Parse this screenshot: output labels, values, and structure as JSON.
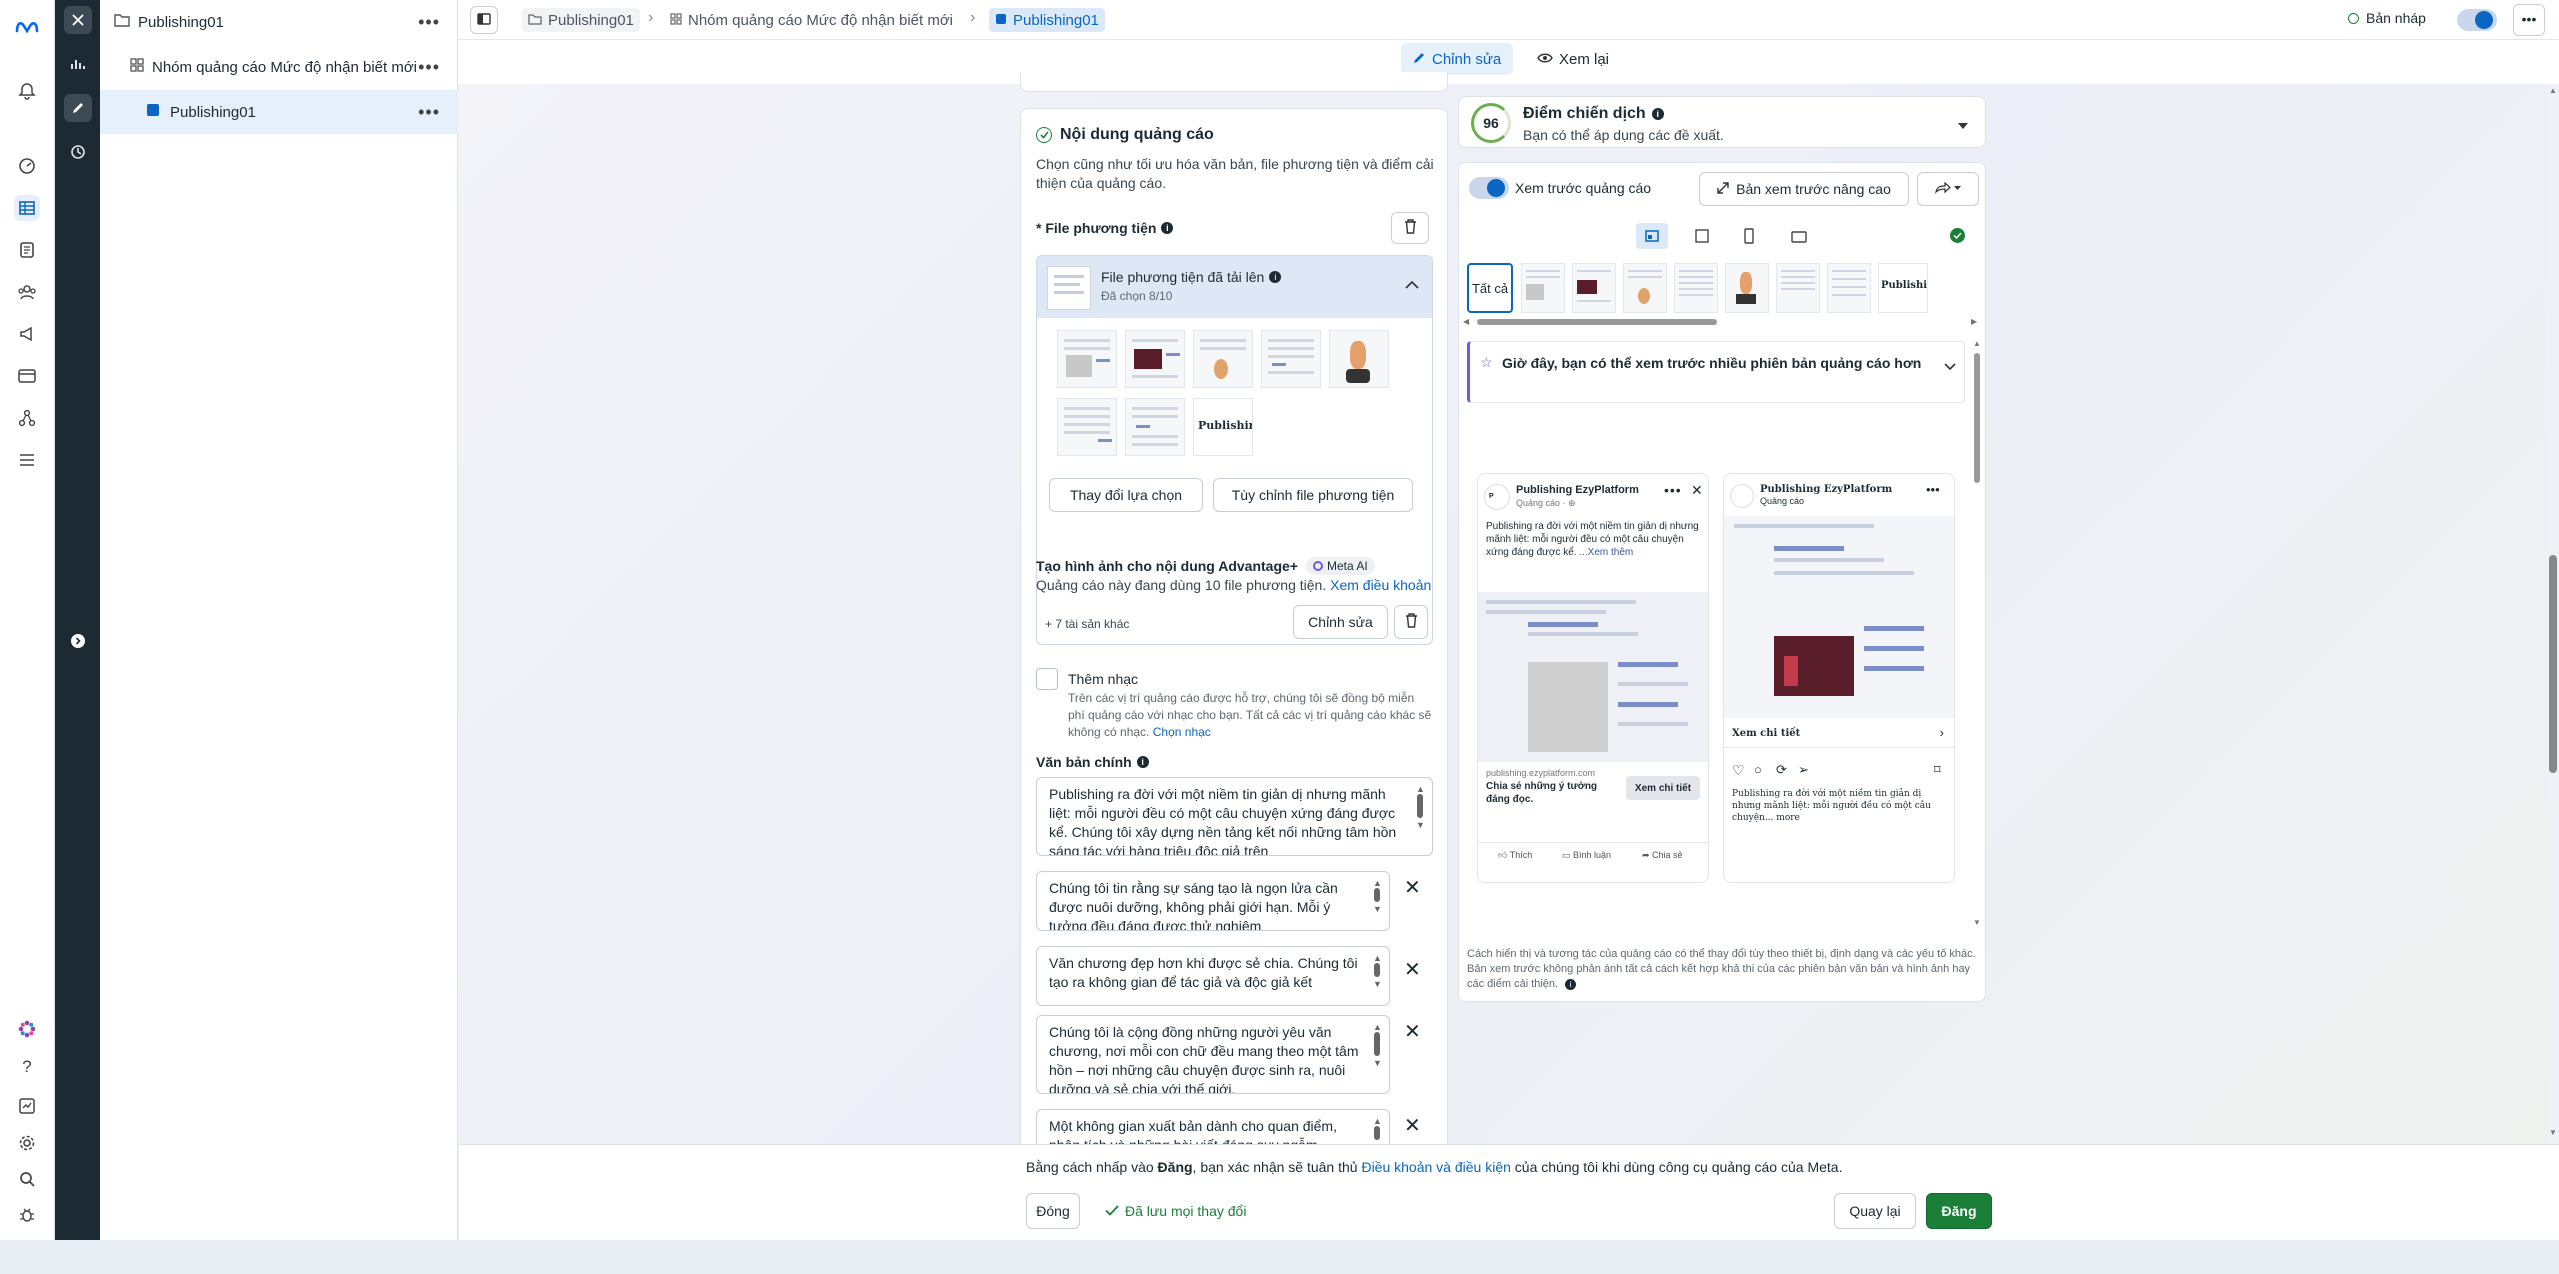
{
  "colors": {
    "accent": "#0a66c2",
    "publish": "#1a7f37",
    "rail_dark": "#1c2b33",
    "score_ring": "#6ab04c"
  },
  "icons": {
    "rail": [
      "meta-logo-icon",
      "bell-icon",
      "dashboard-icon",
      "table-icon",
      "pages-icon",
      "audience-icon",
      "megaphone-icon",
      "billing-icon",
      "network-icon",
      "menu-icon",
      "ai-flower-icon",
      "help-icon",
      "report-icon",
      "settings-icon",
      "search-icon",
      "bug-icon"
    ]
  },
  "tree": {
    "items": [
      {
        "label": "Publishing01"
      },
      {
        "label": "Nhóm quảng cáo Mức độ nhận biết mới"
      },
      {
        "label": "Publishing01"
      }
    ],
    "more": "•••"
  },
  "breadcrumb": {
    "campaign": "Publishing01",
    "adset": "Nhóm quảng cáo Mức độ nhận biết mới",
    "ad": "Publishing01",
    "sep": "›"
  },
  "topbar": {
    "draft": "Bản nháp",
    "more": "•••"
  },
  "modes": {
    "edit": "Chỉnh sửa",
    "review": "Xem lại"
  },
  "content": {
    "title": "Nội dung quảng cáo",
    "desc": "Chọn cũng như tối ưu hóa văn bản, file phương tiện và điểm cải thiện của quảng cáo.",
    "media_label": "* File phương tiện",
    "uploaded_title": "File phương tiện đã tải lên",
    "uploaded_count": "Đã chọn 8/10",
    "thumb_logo": "Publishir",
    "change_btn": "Thay đổi lựa chọn",
    "customize_btn": "Tùy chỉnh file phương tiện",
    "advantage_title": "Tạo hình ảnh cho nội dung Advantage+",
    "meta_ai": "Meta AI",
    "advantage_desc": "Quảng cáo này đang dùng 10 file phương tiện.",
    "terms_link": "Xem điều khoản",
    "other_assets": "+ 7 tài sản khác",
    "edit_btn": "Chỉnh sửa",
    "music_title": "Thêm nhạc",
    "music_desc": "Trên các vị trí quảng cáo được hỗ trợ, chúng tôi sẽ đồng bộ miễn phí quảng cáo với nhạc cho bạn. Tất cả các vị trí quảng cáo khác sẽ không có nhạc.",
    "music_link": "Chọn nhạc",
    "primary_text_label": "Văn bản chính",
    "texts": [
      "Publishing ra đời với một niềm tin giản dị nhưng mãnh liệt: mỗi người đều có một câu chuyện xứng đáng được kể. Chúng tôi xây dựng nền tảng kết nối những tâm hồn sáng tác với hàng triệu độc giả trên",
      "Chúng tôi tin rằng sự sáng tạo là ngọn lửa cần được nuôi dưỡng, không phải giới hạn. Mỗi ý tưởng đều đáng được thử nghiệm",
      "Văn chương đẹp hơn khi được sẻ chia. Chúng tôi tạo ra không gian để tác giả và độc giả kết",
      "Chúng tôi là cộng đồng những người yêu văn chương, nơi mỗi con chữ đều mang theo một tâm hồn – nơi những câu chuyện được sinh ra, nuôi dưỡng và sẻ chia với thế giới.",
      "Một không gian xuất bản dành cho quan điểm, phân tích và những bài viết đáng suy ngẫm"
    ]
  },
  "preview": {
    "score": "96",
    "score_title": "Điểm chiến dịch",
    "score_desc": "Bạn có thể áp dụng các đề xuất.",
    "toggle_label": "Xem trước quảng cáo",
    "advanced_btn": "Bản xem trước nâng cao",
    "all_tab": "Tất cả",
    "thumb_logo": "Publishir",
    "banner": "Giờ đây, bạn có thể xem trước nhiều phiên bản quảng cáo hơn",
    "fb": {
      "page": "Publishing EzyPlatform",
      "sponsored": "Quảng cáo · ⊕",
      "text": "Publishing ra đời với một niềm tin giản dị nhưng mãnh liệt: mỗi người đều có một câu chuyện xứng đáng được kể.",
      "more": "...Xem thêm",
      "domain": "publishing.ezyplatform.com",
      "headline": "Chia sẻ những ý tưởng đáng đọc.",
      "cta": "Xem chi tiết",
      "like": "Thích",
      "comment": "Bình luận",
      "share": "Chia sẻ"
    },
    "ig": {
      "page": "Publishing EzyPlatform",
      "sponsored": "Quảng cáo",
      "cta": "Xem chi tiết",
      "caption": "Publishing ra đời với một niềm tin giản dị nhưng mãnh liệt: mỗi người đều có một câu chuyện... more"
    },
    "note": "Cách hiển thị và tương tác của quảng cáo có thể thay đổi tùy theo thiết bị, định dạng và các yếu tố khác. Bản xem trước không phản ánh tất cả cách kết hợp khả thi của các phiên bản văn bản và hình ảnh hay các điểm cải thiện."
  },
  "footer": {
    "terms_pre": "Bằng cách nhấp vào ",
    "terms_bold": "Đăng",
    "terms_mid": ", bạn xác nhận sẽ tuân thủ ",
    "terms_link": "Điều khoản và điều kiện",
    "terms_post": " của chúng tôi khi dùng công cụ quảng cáo của Meta.",
    "close_btn": "Đóng",
    "saved": "Đã lưu mọi thay đổi",
    "back_btn": "Quay lại",
    "publish_btn": "Đăng"
  }
}
